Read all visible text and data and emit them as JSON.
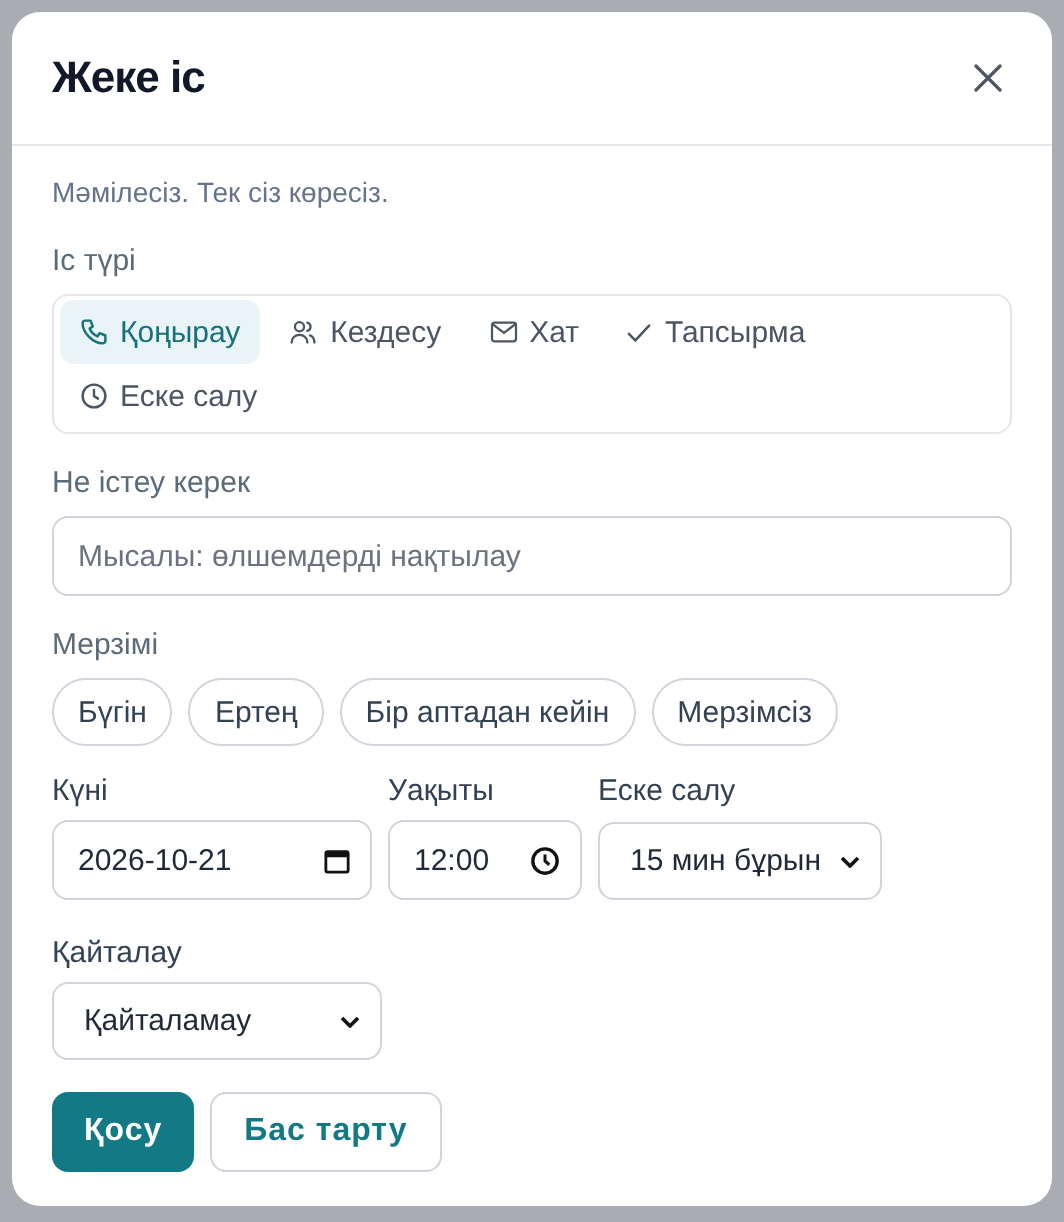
{
  "dialog": {
    "title": "Жеке іс",
    "subtitle": "Мәмілесіз. Тек сіз көресіз.",
    "type_label": "Іс түрі",
    "types": [
      {
        "label": "Қоңырау",
        "kind": "phone",
        "selected": true
      },
      {
        "label": "Кездесу",
        "kind": "people",
        "selected": false
      },
      {
        "label": "Хат",
        "kind": "mail",
        "selected": false
      },
      {
        "label": "Тапсырма",
        "kind": "check",
        "selected": false
      },
      {
        "label": "Еске салу",
        "kind": "clock",
        "selected": false
      }
    ],
    "what_label": "Не істеу керек",
    "what": {
      "placeholder": "Мысалы: өлшемдерді нақтылау"
    },
    "due_label": "Мерзімі",
    "due_options": [
      {
        "label": "Бүгін",
        "selected": false
      },
      {
        "label": "Ертең",
        "selected": false
      },
      {
        "label": "Бір аптадан кейін",
        "selected": false
      },
      {
        "label": "Мерзімсіз",
        "selected": false
      }
    ],
    "date": {
      "label": "Күні",
      "value": "2026-10-21"
    },
    "time": {
      "label": "Уақыты",
      "value": "12:00"
    },
    "reminder": {
      "label": "Еске салу",
      "value": "15 мин бұрын"
    },
    "repeat": {
      "label": "Қайталау",
      "value": "Қайталамау"
    },
    "buttons": [
      {
        "label": "Қосу",
        "kind": "primary"
      },
      {
        "label": "Бас тарту",
        "kind": "secondary"
      }
    ]
  }
}
